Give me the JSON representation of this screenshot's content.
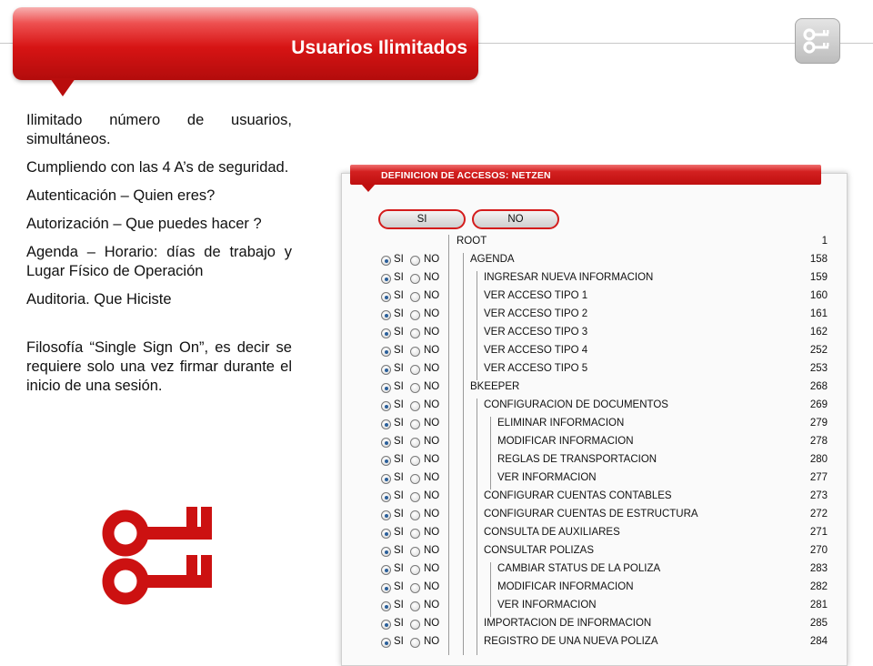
{
  "slide": {
    "title": "Usuarios Ilimitados",
    "bullets": [
      "Ilimitado número de usuarios, simultáneos.",
      "Cumpliendo con las 4 A’s de seguridad.",
      "Autenticación – Quien eres?",
      "Autorización – Que puedes hacer ?",
      "Agenda – Horario: días de trabajo y Lugar Físico de Operación",
      "Auditoria. Que Hiciste",
      "Filosofía “Single Sign On”, es decir se requiere solo una vez firmar durante el inicio de una sesión."
    ],
    "corner_icon": "keys-icon",
    "big_icon": "keys-icon",
    "accent_color": "#d11515"
  },
  "panel": {
    "title": "DEFINICION DE ACCESOS: NETZEN",
    "si_button": "SI",
    "no_button": "NO",
    "si_label": "SI",
    "no_label": "NO",
    "root": {
      "name": "ROOT",
      "id": "1"
    },
    "rows": [
      {
        "name": "AGENDA",
        "id": "158",
        "level": 1
      },
      {
        "name": "INGRESAR NUEVA INFORMACION",
        "id": "159",
        "level": 2
      },
      {
        "name": "VER ACCESO TIPO 1",
        "id": "160",
        "level": 2
      },
      {
        "name": "VER ACCESO TIPO 2",
        "id": "161",
        "level": 2
      },
      {
        "name": "VER ACCESO TIPO 3",
        "id": "162",
        "level": 2
      },
      {
        "name": "VER ACCESO TIPO 4",
        "id": "252",
        "level": 2
      },
      {
        "name": "VER ACCESO TIPO 5",
        "id": "253",
        "level": 2
      },
      {
        "name": "BKEEPER",
        "id": "268",
        "level": 1
      },
      {
        "name": "CONFIGURACION DE DOCUMENTOS",
        "id": "269",
        "level": 2
      },
      {
        "name": "ELIMINAR INFORMACION",
        "id": "279",
        "level": 3
      },
      {
        "name": "MODIFICAR INFORMACION",
        "id": "278",
        "level": 3
      },
      {
        "name": "REGLAS DE TRANSPORTACION",
        "id": "280",
        "level": 3
      },
      {
        "name": "VER INFORMACION",
        "id": "277",
        "level": 3
      },
      {
        "name": "CONFIGURAR CUENTAS CONTABLES",
        "id": "273",
        "level": 2
      },
      {
        "name": "CONFIGURAR CUENTAS DE ESTRUCTURA",
        "id": "272",
        "level": 2
      },
      {
        "name": "CONSULTA DE AUXILIARES",
        "id": "271",
        "level": 2
      },
      {
        "name": "CONSULTAR POLIZAS",
        "id": "270",
        "level": 2
      },
      {
        "name": "CAMBIAR STATUS DE LA POLIZA",
        "id": "283",
        "level": 3
      },
      {
        "name": "MODIFICAR INFORMACION",
        "id": "282",
        "level": 3
      },
      {
        "name": "VER INFORMACION",
        "id": "281",
        "level": 3
      },
      {
        "name": "IMPORTACION DE INFORMACION",
        "id": "285",
        "level": 2
      },
      {
        "name": "REGISTRO DE UNA NUEVA POLIZA",
        "id": "284",
        "level": 2
      }
    ]
  }
}
